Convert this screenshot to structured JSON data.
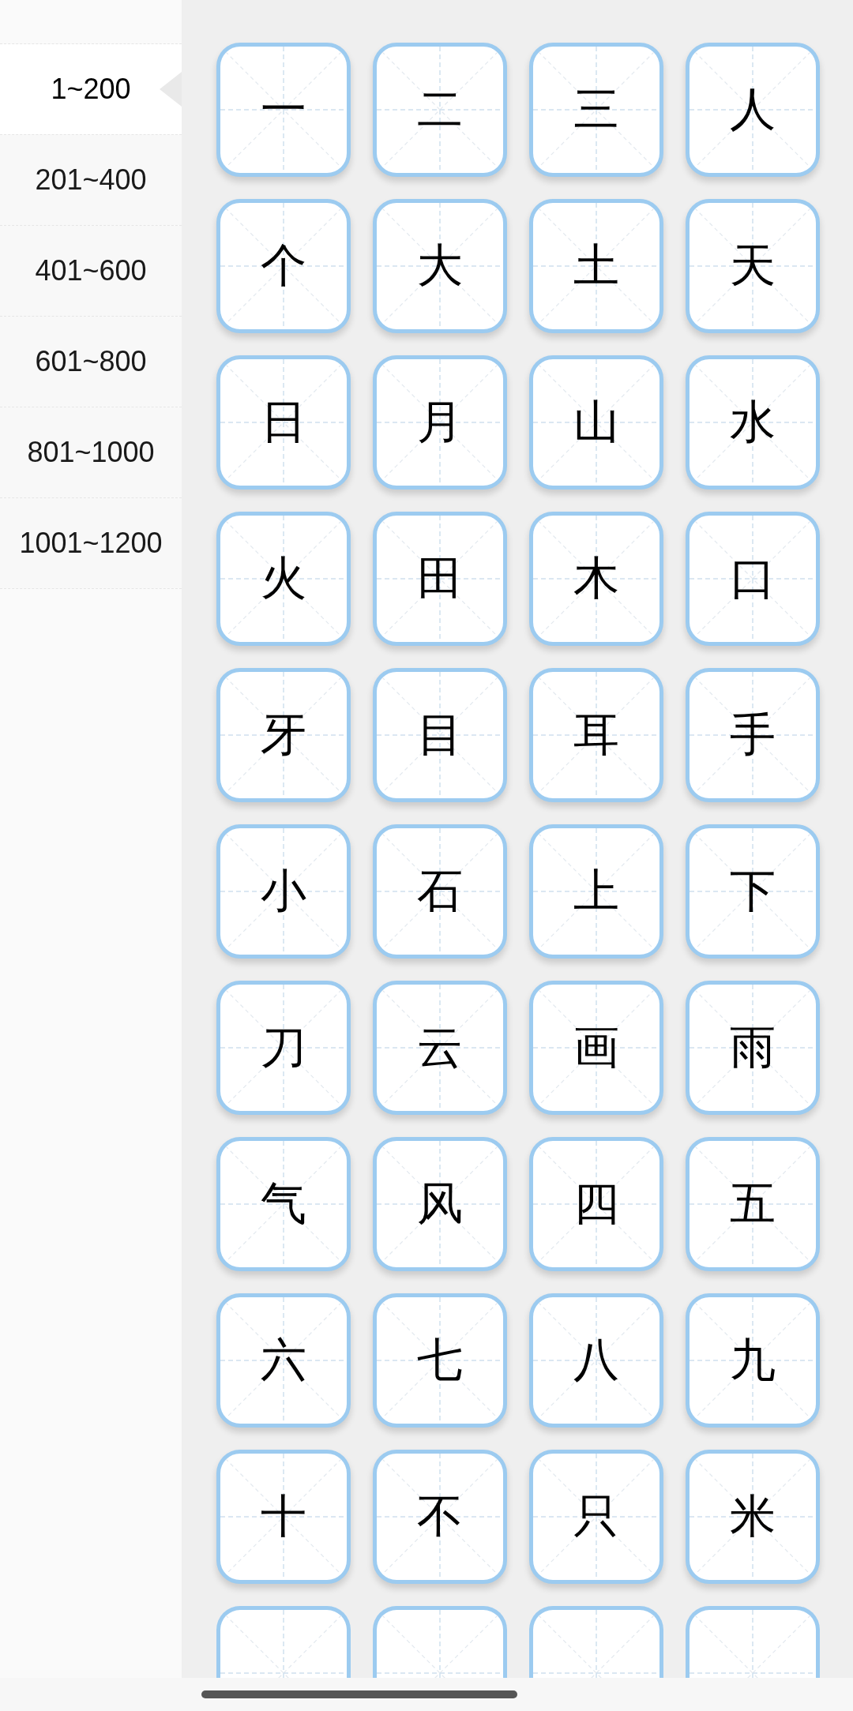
{
  "sidebar": {
    "items": [
      {
        "label": "1~200",
        "selected": true
      },
      {
        "label": "201~400",
        "selected": false
      },
      {
        "label": "401~600",
        "selected": false
      },
      {
        "label": "601~800",
        "selected": false
      },
      {
        "label": "801~1000",
        "selected": false
      },
      {
        "label": "1001~1200",
        "selected": false
      }
    ]
  },
  "characters": [
    "一",
    "二",
    "三",
    "人",
    "个",
    "大",
    "土",
    "天",
    "日",
    "月",
    "山",
    "水",
    "火",
    "田",
    "木",
    "口",
    "牙",
    "目",
    "耳",
    "手",
    "小",
    "石",
    "上",
    "下",
    "刀",
    "云",
    "画",
    "雨",
    "气",
    "风",
    "四",
    "五",
    "六",
    "七",
    "八",
    "九",
    "十",
    "不",
    "只",
    "米"
  ],
  "cut_cards": [
    {
      "kind": "card"
    },
    {
      "kind": "card"
    },
    {
      "kind": "card"
    },
    {
      "kind": "card"
    }
  ]
}
